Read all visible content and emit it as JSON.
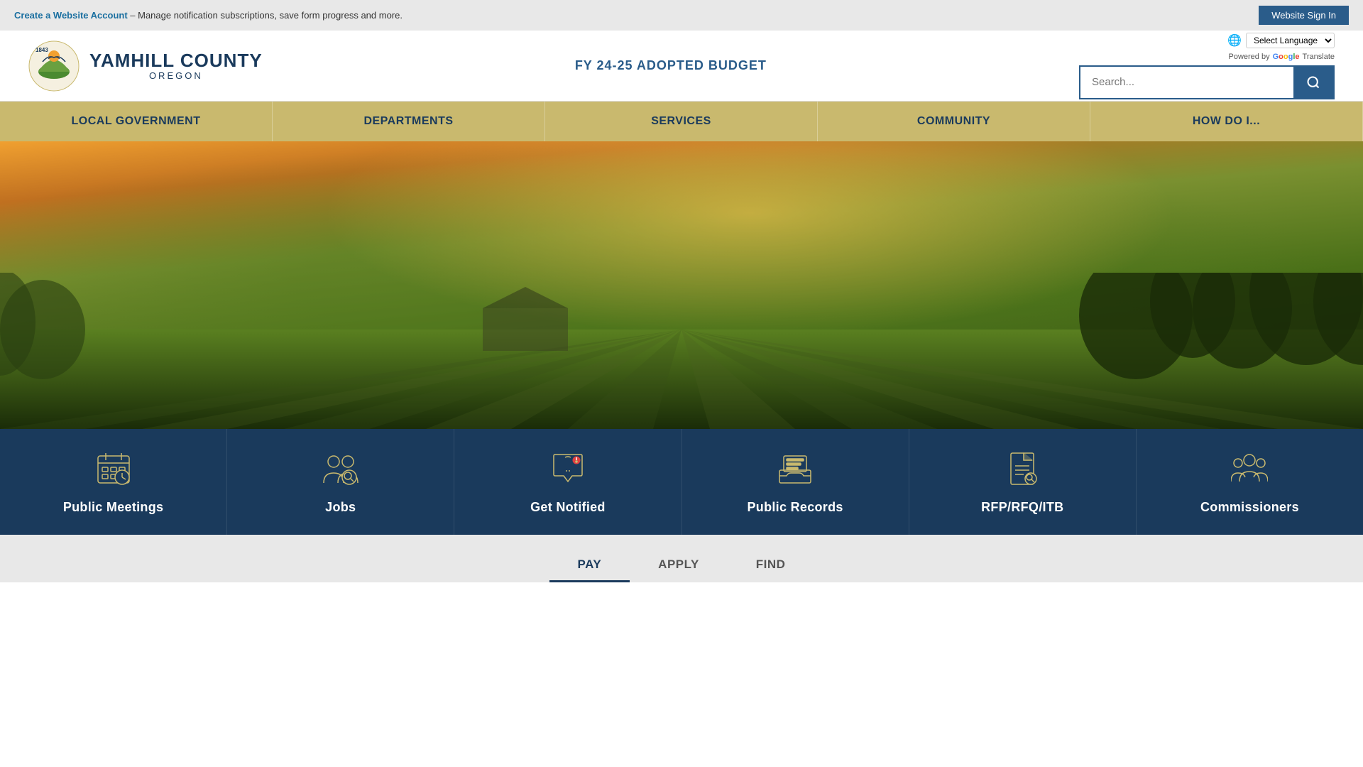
{
  "topbar": {
    "account_link": "Create a Website Account",
    "account_desc": "– Manage notification subscriptions, save form progress and more.",
    "signin_label": "Website Sign In"
  },
  "header": {
    "logo": {
      "year": "1843",
      "county_name": "YAMHILL COUNTY",
      "state": "OREGON"
    },
    "budget_banner": "FY 24-25 ADOPTED BUDGET",
    "translate": {
      "label": "Select Language",
      "powered_by": "Powered by",
      "google": "Google",
      "translate_word": "Translate"
    },
    "search": {
      "placeholder": "Search...",
      "button_label": "Search"
    }
  },
  "nav": {
    "items": [
      {
        "id": "local-government",
        "label": "LOCAL GOVERNMENT"
      },
      {
        "id": "departments",
        "label": "DEPARTMENTS"
      },
      {
        "id": "services",
        "label": "SERVICES"
      },
      {
        "id": "community",
        "label": "COMMUNITY"
      },
      {
        "id": "how-do-i",
        "label": "HOW DO I..."
      }
    ]
  },
  "quick_links": [
    {
      "id": "public-meetings",
      "label": "Public Meetings",
      "icon": "calendar"
    },
    {
      "id": "jobs",
      "label": "Jobs",
      "icon": "people"
    },
    {
      "id": "get-notified",
      "label": "Get Notified",
      "icon": "bell"
    },
    {
      "id": "public-records",
      "label": "Public Records",
      "icon": "inbox"
    },
    {
      "id": "rfp-rfq-itb",
      "label": "RFP/RFQ/ITB",
      "icon": "document"
    },
    {
      "id": "commissioners",
      "label": "Commissioners",
      "icon": "group"
    }
  ],
  "tabs": [
    {
      "id": "pay",
      "label": "PAY",
      "active": true
    },
    {
      "id": "apply",
      "label": "APPLY",
      "active": false
    },
    {
      "id": "find",
      "label": "FIND",
      "active": false
    }
  ]
}
